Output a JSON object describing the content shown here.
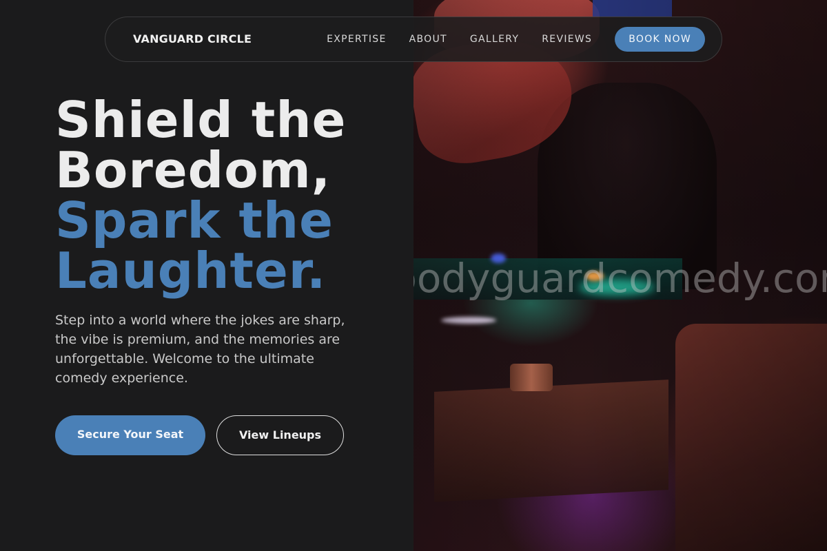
{
  "brand": {
    "name": "VANGUARD CIRCLE"
  },
  "nav": {
    "links": [
      "EXPERTISE",
      "ABOUT",
      "GALLERY",
      "REVIEWS"
    ],
    "cta": "BOOK NOW"
  },
  "hero": {
    "title_line1": "Shield the",
    "title_line2": "Boredom,",
    "title_line3": "Spark the",
    "title_line4": "Laughter.",
    "description": "Step into a world where the jokes are sharp, the vibe is premium, and the memories are unforgettable. Welcome to the ultimate comedy experience.",
    "primary_button": "Secure Your Seat",
    "secondary_button": "View Lineups"
  },
  "image": {
    "watermark": "bodyguardcomedy.com"
  },
  "colors": {
    "background": "#1b1b1c",
    "accent": "#4a80b7",
    "text_primary": "#ececec",
    "text_muted": "#c9c9c9"
  }
}
